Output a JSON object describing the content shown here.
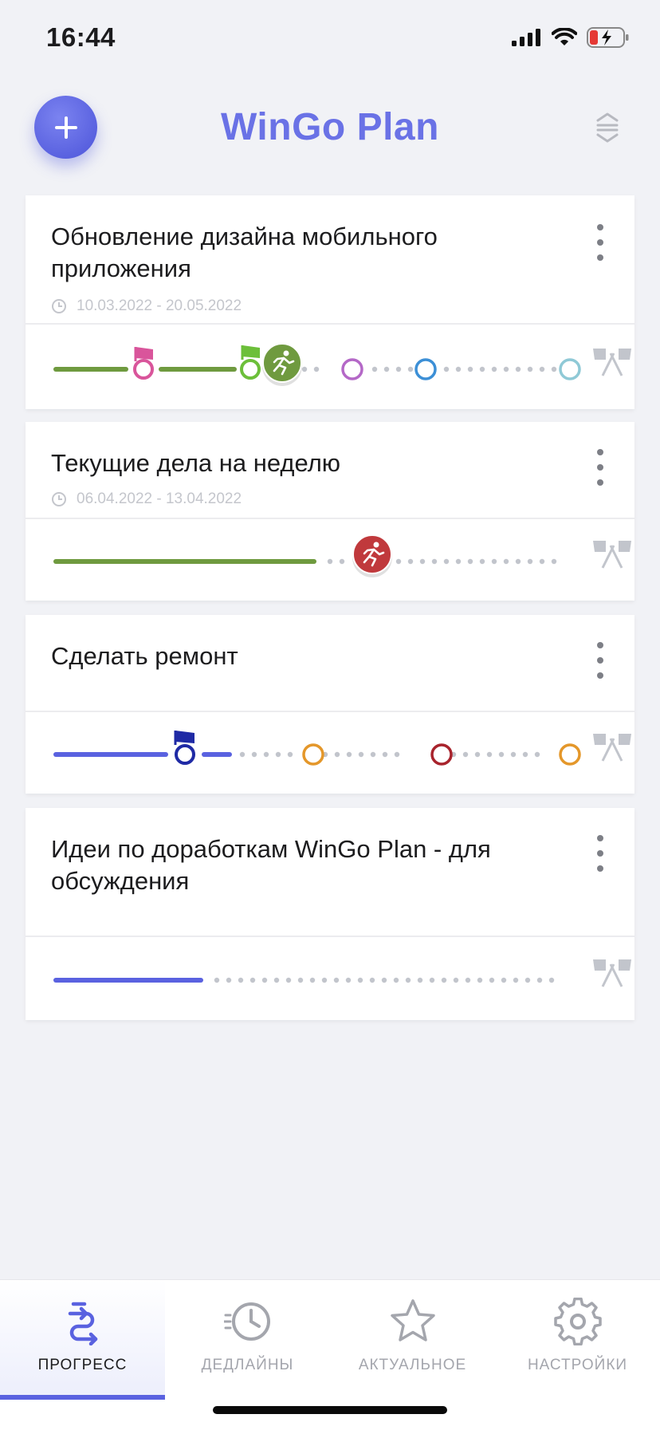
{
  "status_bar": {
    "time": "16:44"
  },
  "header": {
    "title": "WinGo Plan"
  },
  "colors": {
    "accent": "#5a62e0",
    "green": "#6f9a3f",
    "red": "#c0393c",
    "gray": "#c2c5cc"
  },
  "cards": [
    {
      "title": "Обновление дизайна мобильного приложения",
      "dates": "10.03.2022 - 20.05.2022"
    },
    {
      "title": "Текущие дела на неделю",
      "dates": "06.04.2022 - 13.04.2022"
    },
    {
      "title": "Сделать ремонт"
    },
    {
      "title": "Идеи по доработкам WinGo Plan - для обсуждения"
    }
  ],
  "tabs": [
    {
      "label": "ПРОГРЕСС",
      "icon": "progress-arrows-icon"
    },
    {
      "label": "ДЕДЛАЙНЫ",
      "icon": "clock-icon"
    },
    {
      "label": "АКТУАЛЬНОЕ",
      "icon": "star-icon"
    },
    {
      "label": "НАСТРОЙКИ",
      "icon": "gear-icon"
    }
  ]
}
